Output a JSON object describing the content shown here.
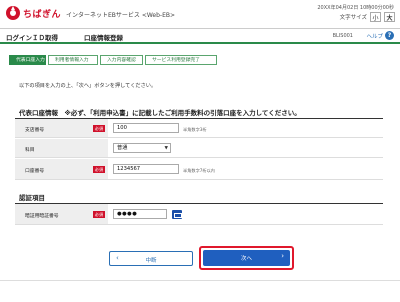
{
  "header": {
    "logo_text": "ちばぎん",
    "service_name": "インターネットEBサービス <Web-EB>",
    "datetime": "20XX年04月02日 10時00分00秒",
    "font_size_label": "文字サイズ",
    "font_small": "小",
    "font_large": "大",
    "brand_color": "#d0112b"
  },
  "titlebar": {
    "login": "ログインＩＤ取得",
    "title": "口座情報登録",
    "screen_code": "BLIS001",
    "help_label": "ヘルプ",
    "help_icon": "question-icon"
  },
  "steps": [
    {
      "label": "代表口座入力",
      "active": true
    },
    {
      "label": "利用者情報入力",
      "active": false
    },
    {
      "label": "入力内容確認",
      "active": false
    },
    {
      "label": "サービス利用登録完了",
      "active": false
    }
  ],
  "instruction": "以下の項目を入力の上、「次へ」ボタンを押してください。",
  "account_section": {
    "title": "代表口座情報　※必ず、「利用申込書」に記載したご利用手数料の引落口座を入力してください。",
    "required_badge": "必須",
    "fields": {
      "branch": {
        "label": "支店番号",
        "value": "100",
        "hint": "半角数字3桁"
      },
      "subject": {
        "label": "科目",
        "value": "普通"
      },
      "account": {
        "label": "口座番号",
        "value": "1234567",
        "hint": "半角数字7桁以内"
      }
    }
  },
  "auth_section": {
    "title": "認証項目",
    "fields": {
      "pin": {
        "label": "暗証用暗証番号",
        "value": "●●●●"
      }
    }
  },
  "buttons": {
    "back": "中断",
    "next": "次へ"
  }
}
